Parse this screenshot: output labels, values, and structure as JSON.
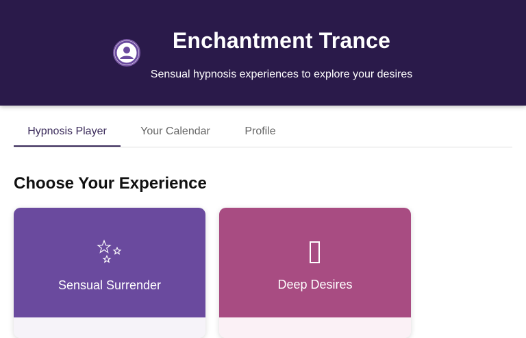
{
  "app": {
    "title": "Enchantment Trance",
    "subtitle": "Sensual hypnosis experiences to explore your desires",
    "avatar_icon": "user-circle-icon"
  },
  "tabs": [
    {
      "label": "Hypnosis Player",
      "active": true
    },
    {
      "label": "Your Calendar",
      "active": false
    },
    {
      "label": "Profile",
      "active": false
    }
  ],
  "main": {
    "section_title": "Choose Your Experience",
    "cards": [
      {
        "label": "Sensual Surrender",
        "icon": "sparkle-stars-icon",
        "color": "#6a4a9e"
      },
      {
        "label": "Deep Desires",
        "icon": "missing-glyph-icon",
        "color": "#a84c82"
      }
    ]
  },
  "colors": {
    "header_bg": "#2a1a4a",
    "active_tab": "#3a2a5a"
  }
}
